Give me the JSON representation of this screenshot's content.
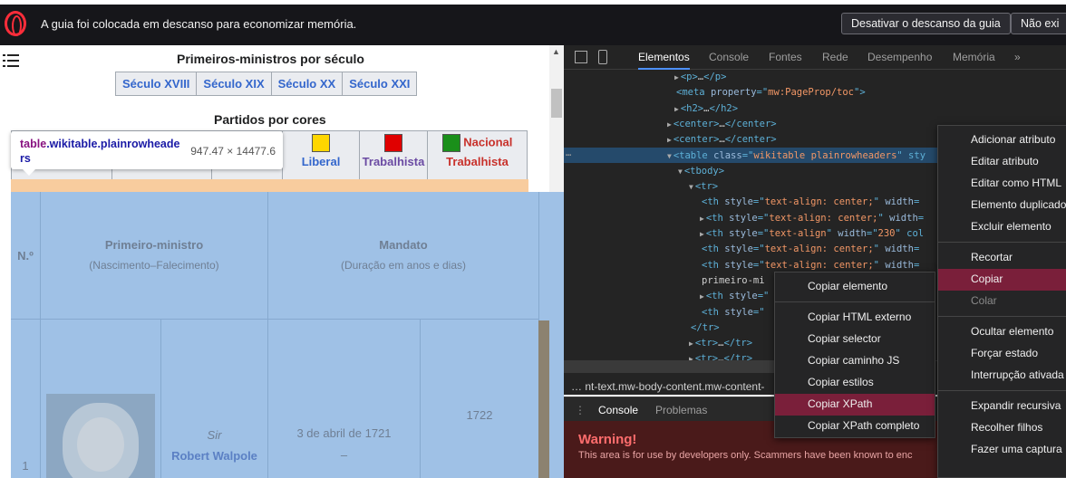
{
  "topbar": {
    "message": "A guia foi colocada em descanso para economizar memória.",
    "disable_button": "Desativar o descanso da guia",
    "no_button": "Não exi"
  },
  "wiki": {
    "title_century": "Primeiros-ministros por século",
    "centuries": [
      "Século XVIII",
      "Século XIX",
      "Século XX",
      "Século XXI"
    ],
    "title_parties": "Partidos por cores",
    "parties": [
      {
        "label": "Liberal",
        "color": "#ffd700",
        "label_color": "#36c"
      },
      {
        "label": "Trabalhista",
        "color": "#e00000",
        "label_color": "#6b4ba3"
      },
      {
        "label_line1": "Nacional",
        "label_line2": "Trabalhista",
        "color": "#1a8f1a",
        "label_color": "#c8312b"
      }
    ],
    "tooltip": {
      "tag": "table",
      "classes": ".wikitable.plainrowheaders",
      "dims": "947.47 × 14477.6"
    },
    "table_headers": {
      "number": "N.º",
      "pm": "Primeiro-ministro",
      "pm_sub": "(Nascimento–Falecimento)",
      "term": "Mandato",
      "term_sub": "(Duração em anos e dias)"
    },
    "row1": {
      "number": "1",
      "sir": "Sir",
      "name": "Robert Walpole",
      "date": "3 de abril de 1721",
      "dash": "–",
      "year": "1722"
    }
  },
  "devtools": {
    "tabs": [
      "Elementos",
      "Console",
      "Fontes",
      "Rede",
      "Desempenho",
      "Memória",
      "»"
    ],
    "dom_lines": [
      {
        "indent": 0,
        "arrow": "▶",
        "parts": [
          [
            "tg",
            "<p>"
          ],
          [
            "tx",
            "…"
          ],
          [
            "tg",
            "</p>"
          ]
        ]
      },
      {
        "indent": 0,
        "arrow": "",
        "parts": [
          [
            "tg",
            "<meta "
          ],
          [
            "an",
            "property"
          ],
          [
            "tg",
            "=\""
          ],
          [
            "av",
            "mw:PageProp/toc"
          ],
          [
            "tg",
            "\">"
          ]
        ]
      },
      {
        "indent": 0,
        "arrow": "▶",
        "parts": [
          [
            "tg",
            "<h2>"
          ],
          [
            "tx",
            "…"
          ],
          [
            "tg",
            "</h2>"
          ]
        ]
      },
      {
        "indent": -1,
        "arrow": "▶",
        "parts": [
          [
            "tg",
            "<center>"
          ],
          [
            "tx",
            "…"
          ],
          [
            "tg",
            "</center>"
          ]
        ]
      },
      {
        "indent": -1,
        "arrow": "▶",
        "parts": [
          [
            "tg",
            "<center>"
          ],
          [
            "tx",
            "…"
          ],
          [
            "tg",
            "</center>"
          ]
        ]
      },
      {
        "indent": -1,
        "arrow": "▼",
        "parts": [
          [
            "tg",
            "<table "
          ],
          [
            "an",
            "class"
          ],
          [
            "tg",
            "=\""
          ],
          [
            "av",
            "wikitable plainrowheaders"
          ],
          [
            "tg",
            "\" sty"
          ]
        ]
      },
      {
        "indent": 1,
        "arrow": "▼",
        "parts": [
          [
            "tg",
            "<tbody>"
          ]
        ]
      },
      {
        "indent": 2,
        "arrow": "▼",
        "parts": [
          [
            "tg",
            "<tr>"
          ]
        ]
      },
      {
        "indent": 3,
        "arrow": "",
        "parts": [
          [
            "tg",
            "<th "
          ],
          [
            "an",
            "style"
          ],
          [
            "tg",
            "=\""
          ],
          [
            "av",
            "text-align: center;"
          ],
          [
            "tg",
            "\" "
          ],
          [
            "an",
            "width"
          ],
          [
            "tg",
            "="
          ]
        ]
      },
      {
        "indent": 3,
        "arrow": "▶",
        "parts": [
          [
            "tg",
            "<th "
          ],
          [
            "an",
            "style"
          ],
          [
            "tg",
            "=\""
          ],
          [
            "av",
            "text-align: center;"
          ],
          [
            "tg",
            "\" "
          ],
          [
            "an",
            "width"
          ],
          [
            "tg",
            "="
          ]
        ]
      },
      {
        "indent": 3,
        "arrow": "▶",
        "parts": [
          [
            "tg",
            "<th "
          ],
          [
            "an",
            "style"
          ],
          [
            "tg",
            "=\""
          ],
          [
            "av",
            "text-align"
          ],
          [
            "tg",
            "\" "
          ],
          [
            "an",
            "width"
          ],
          [
            "tg",
            "=\""
          ],
          [
            "av",
            "230"
          ],
          [
            "tg",
            "\" col"
          ]
        ]
      },
      {
        "indent": 3,
        "arrow": "",
        "parts": [
          [
            "tg",
            "<th "
          ],
          [
            "an",
            "style"
          ],
          [
            "tg",
            "=\""
          ],
          [
            "av",
            "text-align: center;"
          ],
          [
            "tg",
            "\" "
          ],
          [
            "an",
            "width"
          ],
          [
            "tg",
            "="
          ]
        ]
      },
      {
        "indent": 3,
        "arrow": "",
        "parts": [
          [
            "tg",
            "<th "
          ],
          [
            "an",
            "style"
          ],
          [
            "tg",
            "=\""
          ],
          [
            "av",
            "text-align: center;"
          ],
          [
            "tg",
            "\" "
          ],
          [
            "an",
            "width"
          ],
          [
            "tg",
            "="
          ]
        ]
      },
      {
        "indent": 3,
        "arrow": "",
        "parts": [
          [
            "tx",
            "primeiro-mi"
          ]
        ]
      },
      {
        "indent": 3,
        "arrow": "▶",
        "parts": [
          [
            "tg",
            "<th "
          ],
          [
            "an",
            "style"
          ],
          [
            "tg",
            "=\""
          ]
        ]
      },
      {
        "indent": 3,
        "arrow": "",
        "parts": [
          [
            "tg",
            "<th "
          ],
          [
            "an",
            "style"
          ],
          [
            "tg",
            "=\""
          ]
        ]
      },
      {
        "indent": 2,
        "arrow": "",
        "parts": [
          [
            "tg",
            "</tr>"
          ]
        ]
      },
      {
        "indent": 2,
        "arrow": "▶",
        "parts": [
          [
            "tg",
            "<tr>"
          ],
          [
            "tx",
            "…"
          ],
          [
            "tg",
            "</tr>"
          ]
        ]
      },
      {
        "indent": 2,
        "arrow": "▶",
        "parts": [
          [
            "tg",
            "<tr>"
          ],
          [
            "tx",
            "…"
          ],
          [
            "tg",
            "</tr>"
          ]
        ]
      }
    ],
    "ellipsis": "…",
    "breadcrumb": "…  nt-text.mw-body-content.mw-content-",
    "drawer_tabs": [
      "Console",
      "Problemas"
    ],
    "warning_title": "Warning!",
    "warning_text": "This area is for use by developers only. Scammers have been known to enc"
  },
  "copy_menu": [
    {
      "label": "Copiar elemento"
    },
    {
      "sep": true
    },
    {
      "label": "Copiar HTML externo"
    },
    {
      "label": "Copiar selector"
    },
    {
      "label": "Copiar caminho JS"
    },
    {
      "label": "Copiar estilos"
    },
    {
      "label": "Copiar XPath",
      "highlight": true
    },
    {
      "label": "Copiar XPath completo"
    }
  ],
  "main_menu": [
    {
      "label": "Adicionar atributo"
    },
    {
      "label": "Editar atributo"
    },
    {
      "label": "Editar como HTML"
    },
    {
      "label": "Elemento duplicado"
    },
    {
      "label": "Excluir elemento"
    },
    {
      "sep": true
    },
    {
      "label": "Recortar"
    },
    {
      "label": "Copiar",
      "highlight": true
    },
    {
      "label": "Colar",
      "disabled": true
    },
    {
      "sep": true
    },
    {
      "label": "Ocultar elemento"
    },
    {
      "label": "Forçar estado"
    },
    {
      "label": "Interrupção ativada"
    },
    {
      "sep": true
    },
    {
      "label": "Expandir recursiva"
    },
    {
      "label": "Recolher filhos"
    },
    {
      "label": "Fazer uma captura"
    }
  ]
}
